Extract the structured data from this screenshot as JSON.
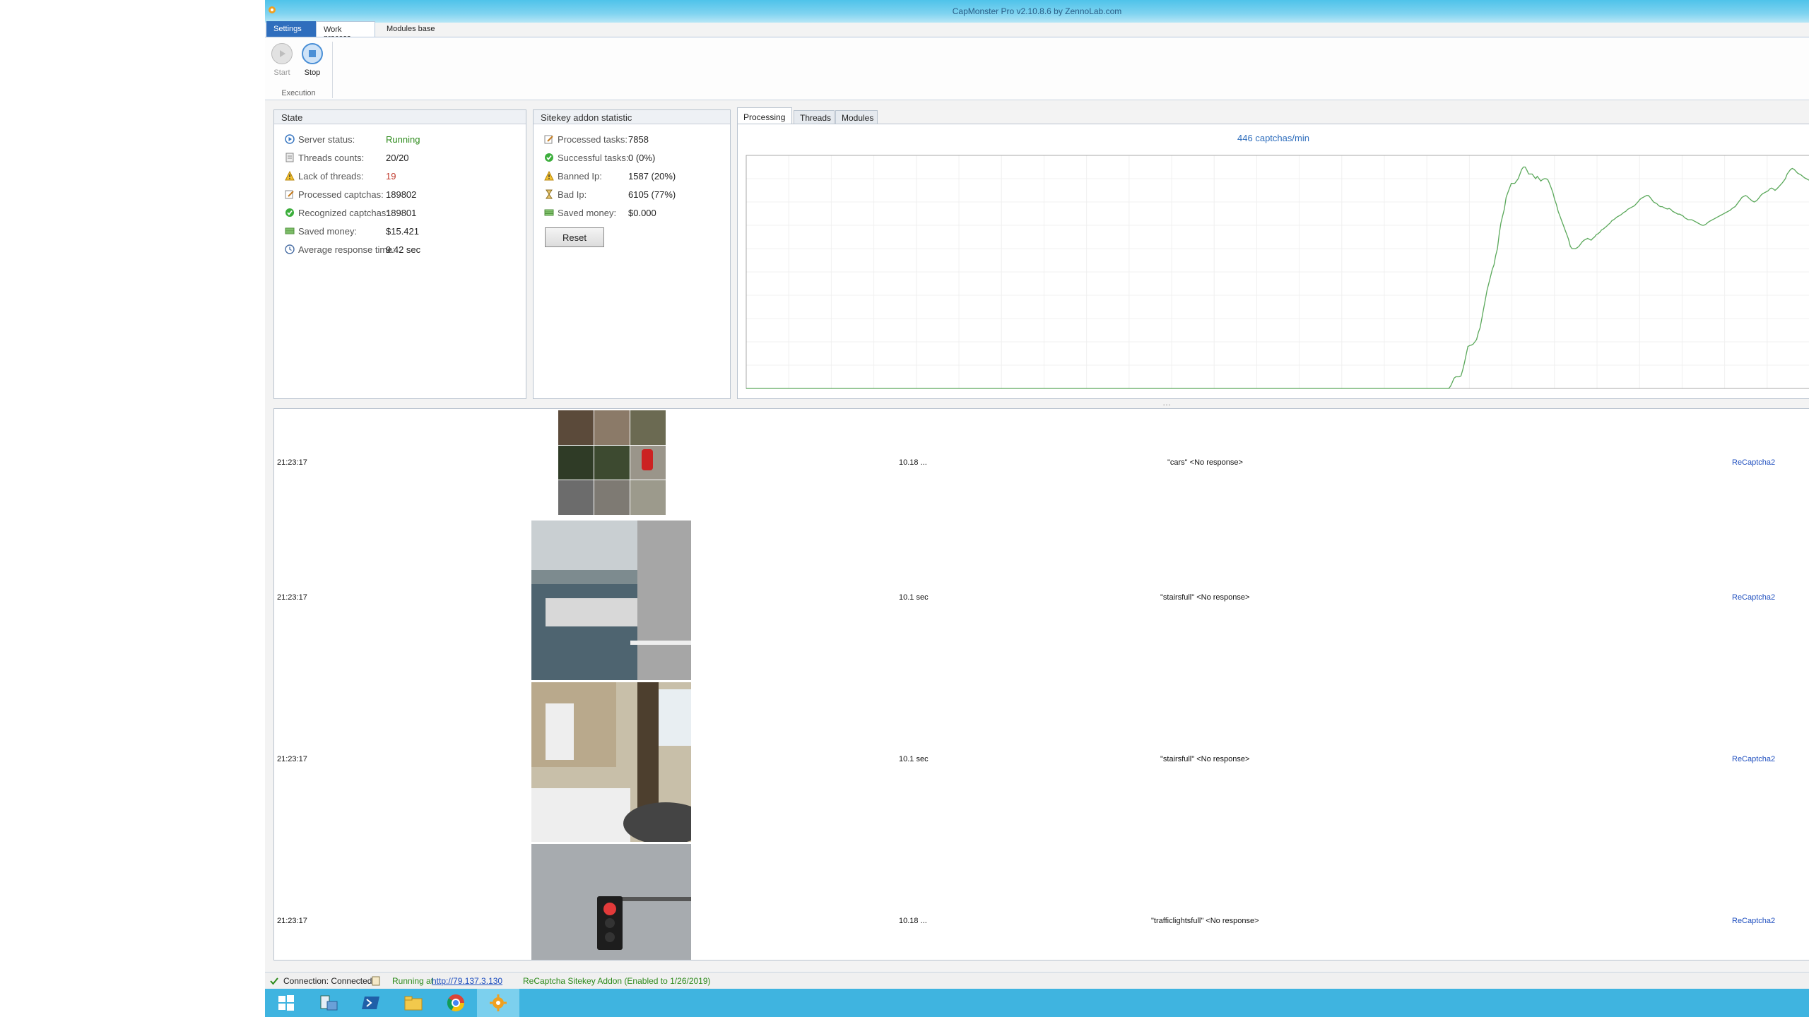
{
  "window": {
    "title": "CapMonster Pro v2.10.8.6 by ZennoLab.com"
  },
  "ribbon": {
    "tabs": [
      "Settings",
      "Work process",
      "Modules base"
    ],
    "start_label": "Start",
    "stop_label": "Stop",
    "group_label": "Execution"
  },
  "state": {
    "title": "State",
    "items": [
      {
        "key": "Server status:",
        "value": "Running",
        "icon": "play-circle-icon"
      },
      {
        "key": "Threads counts:",
        "value": "20/20",
        "icon": "document-icon"
      },
      {
        "key": "Lack of threads:",
        "value": "19",
        "icon": "warning-icon"
      },
      {
        "key": "Processed captchas:",
        "value": "189802",
        "icon": "edit-icon"
      },
      {
        "key": "Recognized captchas:",
        "value": "189801",
        "icon": "check-circle-icon"
      },
      {
        "key": "Saved money:",
        "value": "$15.421",
        "icon": "money-icon"
      },
      {
        "key": "Average response time:",
        "value": "9.42 sec",
        "icon": "clock-icon"
      }
    ]
  },
  "sitekey": {
    "title": "Sitekey addon statistic",
    "items": [
      {
        "key": "Processed tasks:",
        "value": "7858",
        "icon": "edit-icon"
      },
      {
        "key": "Successful tasks:",
        "value": "0 (0%)",
        "icon": "check-circle-icon"
      },
      {
        "key": "Banned Ip:",
        "value": "1587 (20%)",
        "icon": "warning-icon"
      },
      {
        "key": "Bad Ip:",
        "value": "6105 (77%)",
        "icon": "hourglass-icon"
      },
      {
        "key": "Saved money:",
        "value": "$0.000",
        "icon": "money-icon"
      }
    ],
    "reset_label": "Reset"
  },
  "chart_tabs": [
    "Processing",
    "Threads",
    "Modules"
  ],
  "chart_rate": "446 captchas/min",
  "chart_data": {
    "type": "line",
    "title": "",
    "xlabel": "",
    "ylabel": "",
    "grid": true,
    "color": "#5aa85a",
    "y": [
      0,
      0,
      0,
      0,
      0,
      0,
      0,
      0,
      0,
      0,
      0,
      0,
      0,
      0,
      0,
      0,
      0,
      0,
      0,
      0,
      0,
      0,
      0,
      0,
      0,
      0,
      0,
      0,
      0,
      0,
      0,
      0,
      0,
      0,
      0,
      0,
      0,
      0,
      0,
      0,
      0,
      0,
      0,
      0,
      0,
      0,
      0,
      0,
      0,
      0,
      0,
      0,
      0,
      0,
      0,
      0,
      0,
      0,
      0,
      0,
      0,
      0,
      0,
      0,
      0,
      0,
      0,
      0,
      0,
      0,
      0,
      0,
      0,
      0,
      0,
      0,
      0,
      0,
      0,
      0,
      0,
      0,
      0,
      0,
      0,
      0,
      0,
      0,
      0,
      0,
      0,
      0,
      0,
      0,
      0,
      0,
      0,
      0,
      0,
      0,
      0,
      0,
      0,
      0,
      0,
      0,
      0,
      0,
      0,
      0,
      0,
      0,
      0,
      0,
      0,
      0,
      0,
      0,
      0,
      0,
      0,
      0,
      0,
      0,
      0,
      0,
      0,
      0,
      0,
      0,
      0,
      0,
      0,
      0,
      0,
      0,
      0,
      0,
      0,
      0,
      0,
      0,
      0,
      0,
      0,
      0,
      0,
      0,
      0,
      0,
      0,
      0,
      0,
      0,
      0,
      0,
      0,
      0,
      0,
      0,
      0,
      0,
      0,
      0,
      0,
      0,
      0,
      0,
      0,
      0,
      0,
      0,
      0,
      0,
      0,
      0,
      0,
      0,
      0,
      0,
      0,
      0,
      0,
      0,
      0,
      0,
      0,
      0,
      0,
      0,
      0,
      0,
      0,
      0,
      0,
      0,
      0,
      0,
      0,
      0,
      0,
      0,
      0,
      0,
      0,
      0,
      0,
      0,
      0,
      0,
      0,
      0,
      0,
      0,
      0,
      0,
      0,
      0,
      0,
      0,
      0,
      0,
      0,
      0,
      0,
      0,
      0,
      0,
      0,
      0,
      0,
      0,
      0,
      0,
      0,
      0,
      0,
      0,
      0,
      0,
      0,
      0,
      0,
      0,
      0,
      0,
      0,
      0,
      0,
      0,
      0,
      0,
      0,
      0,
      0,
      0,
      0,
      0,
      0,
      0,
      0,
      0,
      0,
      0,
      0,
      0,
      0,
      0,
      0,
      0,
      0,
      0,
      0,
      0,
      0,
      0,
      0,
      0,
      0,
      0,
      0,
      0,
      0,
      0,
      0,
      0,
      0,
      0,
      0,
      0,
      0,
      0,
      0,
      0,
      0,
      0,
      0,
      0,
      0,
      0,
      0,
      0,
      0,
      0,
      0,
      0,
      0,
      0,
      0,
      0,
      0,
      0,
      0,
      0,
      0,
      0,
      0,
      0,
      0,
      0,
      0,
      0,
      0,
      0,
      0,
      0,
      0,
      0,
      0,
      0,
      0,
      0,
      0,
      0,
      0,
      0,
      0,
      0,
      0,
      0,
      0,
      0,
      0,
      0,
      0,
      0,
      0,
      0,
      0,
      0,
      0,
      0,
      0,
      0,
      0,
      0,
      0,
      0,
      0,
      0,
      0,
      0,
      0,
      0,
      0,
      0,
      0,
      0,
      0,
      0,
      0,
      0,
      0,
      0,
      0,
      0,
      0,
      0,
      0,
      0,
      0,
      0,
      0,
      0,
      0,
      0,
      0,
      0,
      0,
      0,
      0,
      0,
      0,
      0,
      0,
      0,
      0,
      0,
      0,
      0,
      0,
      0,
      0,
      0,
      0,
      0,
      5,
      13,
      22,
      25,
      25,
      25,
      27,
      40,
      55,
      73,
      90,
      92,
      93,
      95,
      100,
      105,
      120,
      130,
      150,
      170,
      190,
      210,
      225,
      240,
      255,
      265,
      285,
      300,
      330,
      355,
      370,
      385,
      410,
      420,
      430,
      440,
      440,
      440,
      445,
      450,
      460,
      470,
      475,
      475,
      468,
      460,
      460,
      460,
      455,
      450,
      455,
      450,
      445,
      448,
      450,
      450,
      448,
      440,
      430,
      420,
      405,
      395,
      380,
      370,
      360,
      350,
      340,
      330,
      320,
      305,
      300,
      300,
      300,
      302,
      305,
      310,
      315,
      318,
      320,
      322,
      320,
      318,
      322,
      325,
      330,
      332,
      335,
      340,
      342,
      345,
      348,
      352,
      355,
      360,
      362,
      365,
      368,
      370,
      372,
      375,
      378,
      380,
      384,
      386,
      388,
      390,
      392,
      396,
      400,
      405,
      408,
      410,
      412,
      414,
      414,
      410,
      405,
      400,
      398,
      396,
      392,
      390,
      390,
      388,
      386,
      385,
      386,
      384,
      380,
      378,
      376,
      374,
      374,
      372,
      370,
      366,
      364,
      362,
      362,
      362,
      360,
      358,
      356,
      354,
      352,
      350,
      350,
      352,
      355,
      358,
      360,
      362,
      364,
      366,
      368,
      370,
      372,
      374,
      376,
      378,
      380,
      382,
      385,
      388,
      390,
      395,
      400,
      405,
      410,
      412,
      414,
      412,
      408,
      405,
      402,
      400,
      402,
      405,
      410,
      415,
      418,
      420,
      422,
      424,
      428,
      430,
      428,
      425,
      428,
      432,
      436,
      440,
      445,
      450,
      460,
      465,
      470,
      472,
      470,
      466,
      462,
      460,
      458,
      455,
      452,
      450,
      448,
      446
    ],
    "ylim": [
      0,
      500
    ]
  },
  "log": {
    "rows": [
      {
        "time": "21:23:17",
        "duration": "10.18 ...",
        "task": "\"cars\" <No response>",
        "type": "ReCaptcha2"
      },
      {
        "time": "21:23:17",
        "duration": "10.1 sec",
        "task": "\"stairsfull\" <No response>",
        "type": "ReCaptcha2"
      },
      {
        "time": "21:23:17",
        "duration": "10.1 sec",
        "task": "\"stairsfull\" <No response>",
        "type": "ReCaptcha2"
      },
      {
        "time": "21:23:17",
        "duration": "10.18 ...",
        "task": "\"trafficlightsfull\" <No response>",
        "type": "ReCaptcha2"
      }
    ]
  },
  "statusbar": {
    "connection": "Connection: Connected",
    "running_prefix": "Running at",
    "running_url": "http://79.137.3.130",
    "addon": "ReCaptcha Sitekey Addon (Enabled to 1/26/2019)"
  },
  "colors": {
    "accent": "#2f6ebd",
    "taskbar": "#3fb4e0",
    "green": "#2c8a1a",
    "red": "#c0392b"
  }
}
